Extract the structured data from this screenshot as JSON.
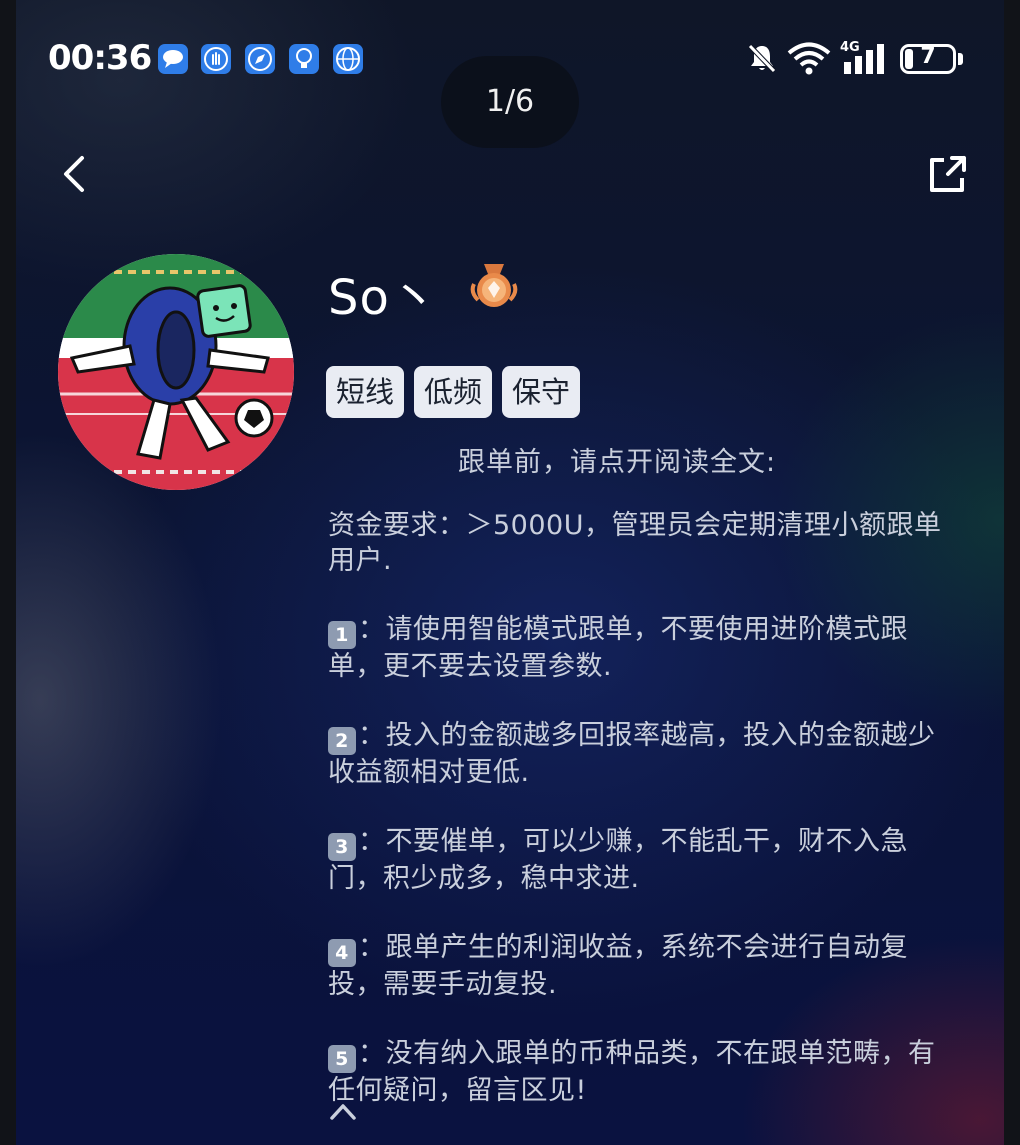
{
  "status_bar": {
    "time": "00:36",
    "notification_icons": [
      "chat-icon",
      "hand-icon",
      "compass-icon",
      "lightbulb-icon",
      "globe-icon"
    ],
    "network": "4G",
    "battery_level": "7"
  },
  "viewer": {
    "page_counter": "1/6"
  },
  "profile": {
    "username": "So丶",
    "tags": [
      "短线",
      "低频",
      "保守"
    ]
  },
  "post": {
    "intro": "跟单前，请点开阅读全文:",
    "requirement": "资金要求：＞5000U，管理员会定期清理小额跟单用户.",
    "items": [
      {
        "num": "1",
        "text": "：请使用智能模式跟单，不要使用进阶模式跟单，更不要去设置参数."
      },
      {
        "num": "2",
        "text": "：投入的金额越多回报率越高，投入的金额越少收益额相对更低."
      },
      {
        "num": "3",
        "text": "：不要催单，可以少赚，不能乱干，财不入急门，积少成多，稳中求进."
      },
      {
        "num": "4",
        "text": "：跟单产生的利润收益，系统不会进行自动复投，需要手动复投."
      },
      {
        "num": "5",
        "text": "：没有纳入跟单的币种品类，不在跟单范畴，有任何疑问，留言区见!"
      }
    ]
  },
  "colors": {
    "background": "#0b1230",
    "tag_bg": "#e9ecf3",
    "body_text": "#c9cfdc",
    "keycap": "#8e9bb1"
  }
}
